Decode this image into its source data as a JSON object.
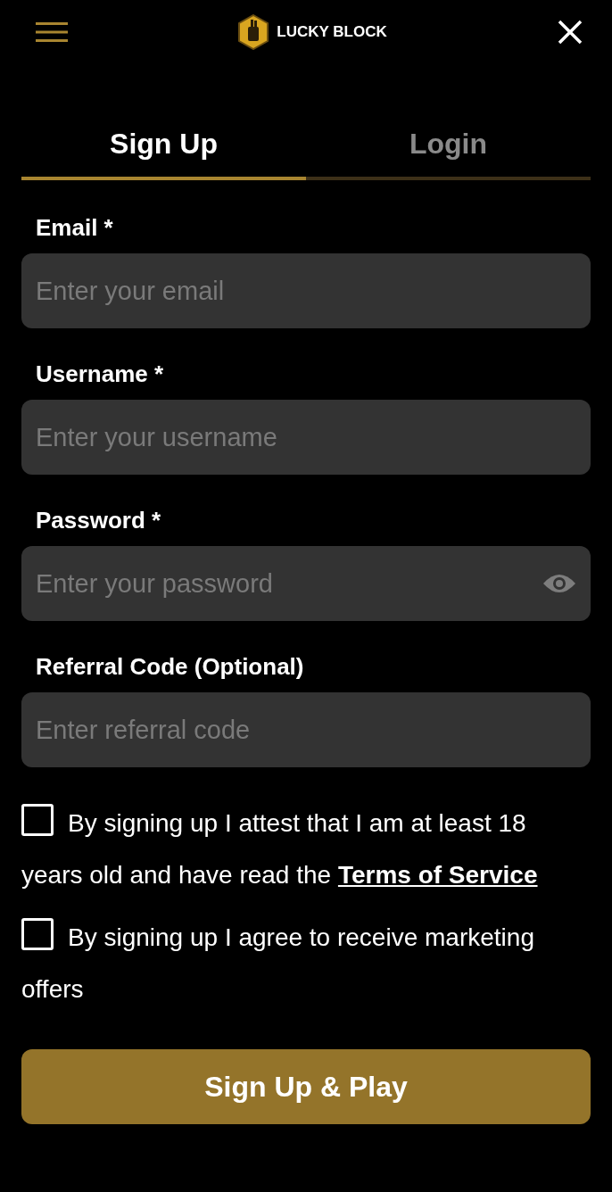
{
  "header": {
    "brand": "LUCKY BLOCK"
  },
  "tabs": [
    {
      "label": "Sign Up",
      "selected": true
    },
    {
      "label": "Login",
      "selected": false
    }
  ],
  "fields": [
    {
      "label": "Email *",
      "placeholder": "Enter your email",
      "kind": "text"
    },
    {
      "label": "Username *",
      "placeholder": "Enter your username",
      "kind": "text"
    },
    {
      "label": "Password *",
      "placeholder": "Enter your password",
      "kind": "password"
    },
    {
      "label": "Referral Code (Optional)",
      "placeholder": "Enter referral code",
      "kind": "text"
    }
  ],
  "consents": [
    {
      "text": "By signing up I attest that I am at least 18 years old and have read the ",
      "link": "Terms of Service",
      "checked": false
    },
    {
      "text": "By signing up I agree to receive marketing offers",
      "checked": false
    }
  ],
  "submit": "Sign Up & Play"
}
